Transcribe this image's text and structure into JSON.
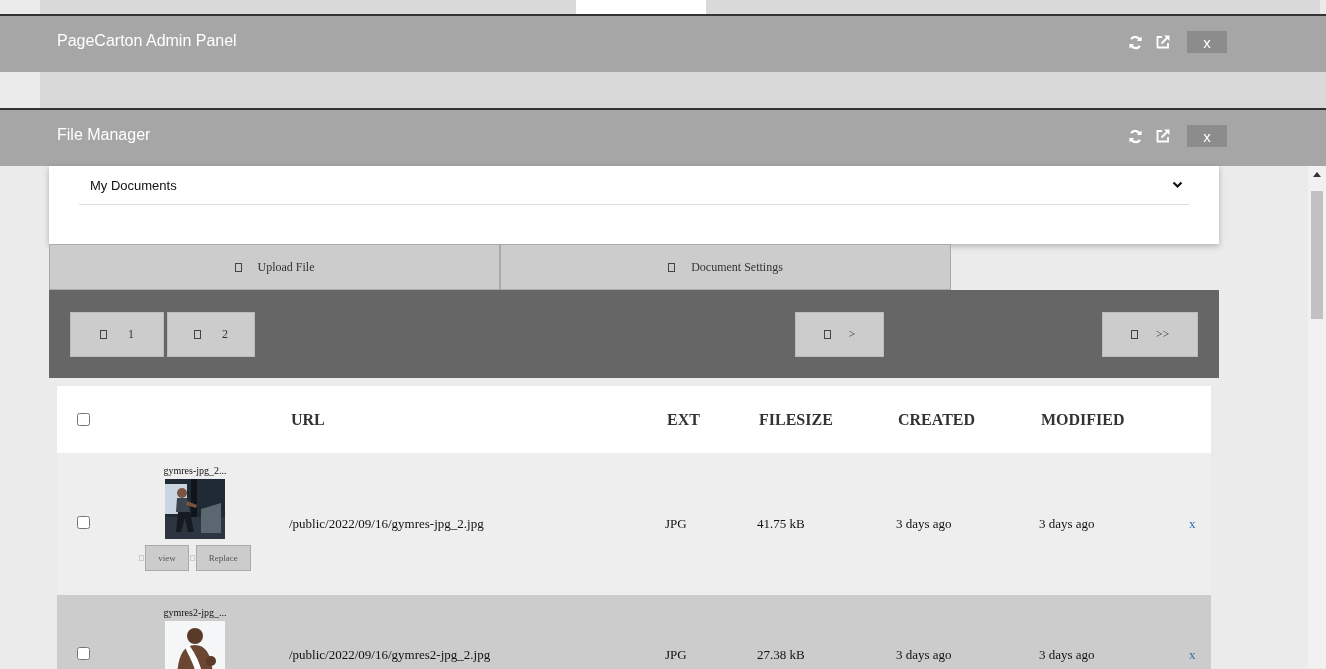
{
  "windows": [
    {
      "title": "PageCarton Admin Panel",
      "close_label": "x"
    },
    {
      "title": "File Manager",
      "close_label": "x"
    }
  ],
  "folder_select": {
    "value": "My Documents"
  },
  "actions": [
    "Upload File",
    "Document Settings"
  ],
  "pager": {
    "pages": [
      "1",
      "2"
    ],
    "next": ">",
    "last": ">>"
  },
  "table": {
    "header_checked": false,
    "columns": [
      "URL",
      "EXT",
      "FILESIZE",
      "CREATED",
      "MODIFIED"
    ],
    "rows": [
      {
        "name": "gymres-jpg_2...",
        "buttons": [
          "view",
          "Replace"
        ],
        "checked": false,
        "url": "/public/2022/09/16/gymres-jpg_2.jpg",
        "ext": "JPG",
        "size": "41.75 kB",
        "created": "3 days ago",
        "modified": "3 days ago",
        "delete": "x"
      },
      {
        "name": "gymres2-jpg_...",
        "checked": false,
        "url": "/public/2022/09/16/gymres2-jpg_2.jpg",
        "ext": "JPG",
        "size": "27.38 kB",
        "created": "3 days ago",
        "modified": "3 days ago",
        "delete": "x"
      }
    ]
  }
}
